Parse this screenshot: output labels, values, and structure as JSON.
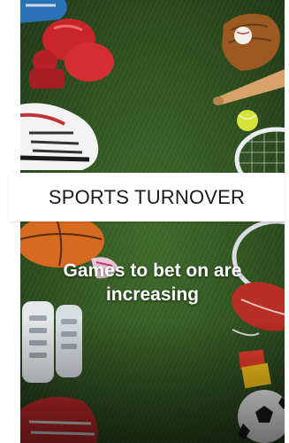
{
  "card": {
    "title": "SPORTS TURNOVER",
    "headline": "Games to bet on are increasing"
  },
  "background": {
    "icons": [
      "boxing-gloves-icon",
      "baseball-glove-icon",
      "baseball-bat-icon",
      "tennis-ball-icon",
      "tennis-racket-icon",
      "sneaker-icon",
      "basketball-icon",
      "rugby-ball-icon",
      "shin-guard-icon",
      "red-card-icon",
      "yellow-card-icon",
      "soccer-ball-icon",
      "helmet-icon"
    ],
    "turf_color": "#2f5220"
  }
}
